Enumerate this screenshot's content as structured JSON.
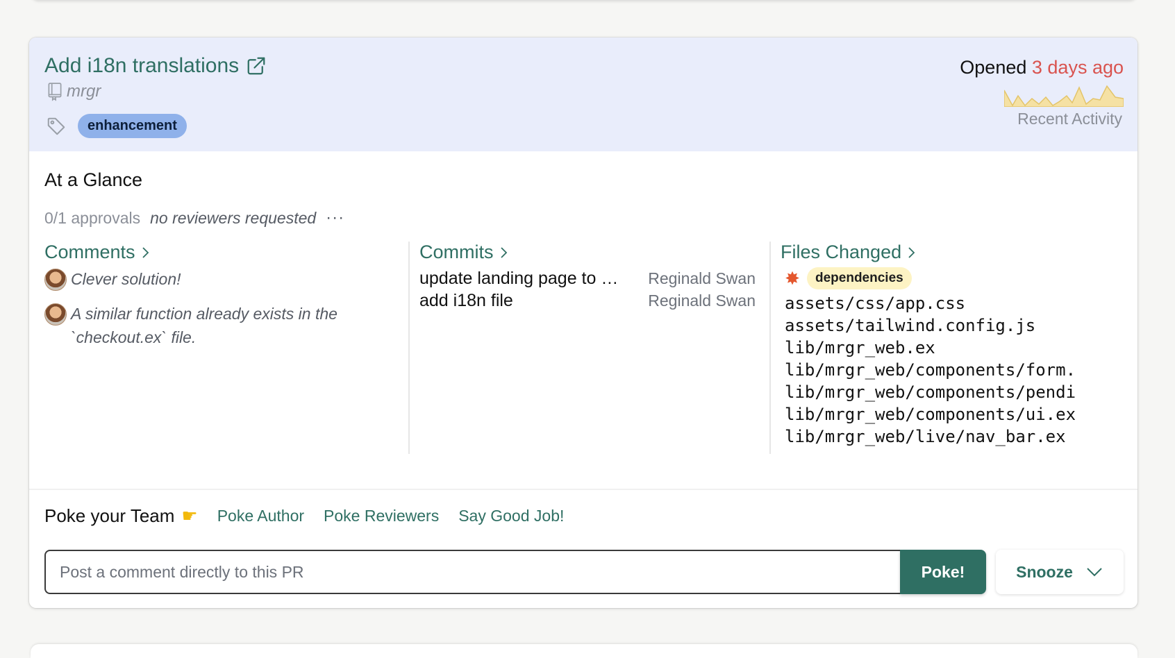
{
  "pr": {
    "title": "Add i18n translations",
    "repo": "mrgr",
    "label": "enhancement",
    "opened_prefix": "Opened",
    "opened_ago": "3 days ago",
    "recent_activity": "Recent Activity"
  },
  "glance": {
    "title": "At a Glance",
    "approvals": "0/1 approvals",
    "reviewers": "no reviewers requested",
    "more": "···"
  },
  "comments": {
    "heading": "Comments",
    "items": [
      {
        "text": "Clever solution!"
      },
      {
        "text": "A similar function already exists in the `checkout.ex` file."
      }
    ]
  },
  "commits": {
    "heading": "Commits",
    "items": [
      {
        "message": "update landing page to …",
        "author": "Reginald Swan"
      },
      {
        "message": "add i18n file",
        "author": "Reginald Swan"
      }
    ]
  },
  "files": {
    "heading": "Files Changed",
    "dep_label": "dependencies",
    "items": [
      "assets/css/app.css",
      "assets/tailwind.config.js",
      "lib/mrgr_web.ex",
      "lib/mrgr_web/components/form.",
      "lib/mrgr_web/components/pendi",
      "lib/mrgr_web/components/ui.ex",
      "lib/mrgr_web/live/nav_bar.ex"
    ]
  },
  "poke": {
    "title": "Poke your Team",
    "author": "Poke Author",
    "reviewers": "Poke Reviewers",
    "good_job": "Say Good Job!",
    "input_placeholder": "Post a comment directly to this PR",
    "button": "Poke!",
    "snooze": "Snooze"
  },
  "colors": {
    "accent": "#2f6f63",
    "header_bg": "#e9edfb",
    "ago": "#d9534f",
    "sparkline": "#f3d98b"
  }
}
